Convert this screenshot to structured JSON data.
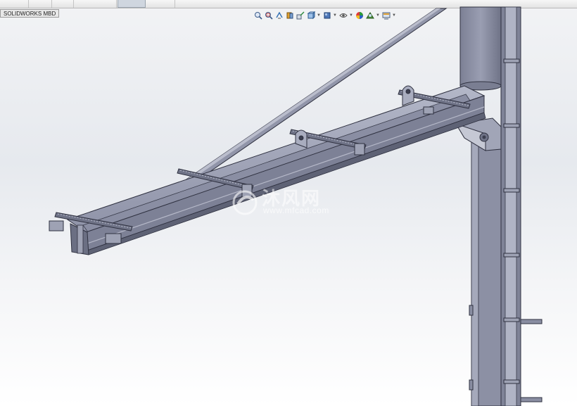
{
  "window": {
    "tab_label": "SOLIDWORKS MBD"
  },
  "heads_up_toolbar": {
    "tools": [
      {
        "icon": "zoom-to-fit-icon"
      },
      {
        "icon": "zoom-to-area-icon"
      },
      {
        "icon": "previous-view-icon"
      },
      {
        "icon": "section-view-icon"
      },
      {
        "icon": "dynamic-annotation-views-icon"
      },
      {
        "icon": "view-orientation-icon",
        "dropdown": true
      },
      {
        "icon": "display-style-icon",
        "dropdown": true
      },
      {
        "icon": "hide-show-items-icon",
        "dropdown": true
      },
      {
        "icon": "edit-appearance-icon"
      },
      {
        "icon": "apply-scene-icon",
        "dropdown": true
      },
      {
        "icon": "view-settings-icon",
        "dropdown": true
      }
    ]
  },
  "watermark": {
    "chinese_text": "沐风网",
    "url": "www.mfcad.com"
  },
  "colors": {
    "steel": "#8f93a8",
    "steel_dark": "#55596b",
    "steel_light": "#b8bccb",
    "outline": "#2f3140"
  }
}
